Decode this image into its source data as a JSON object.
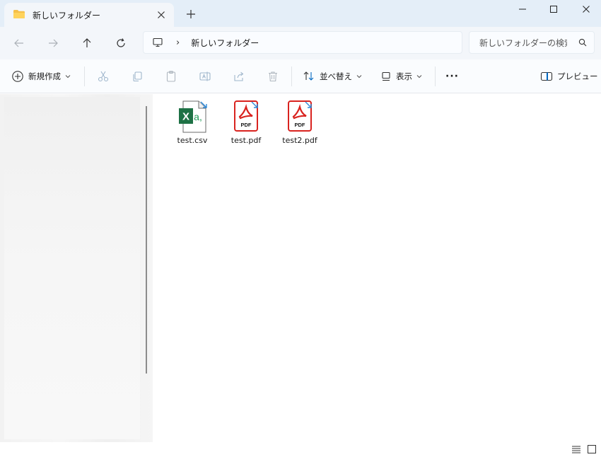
{
  "window": {
    "tab_title": "新しいフォルダー",
    "new_tab": "+",
    "minimize": "minimize",
    "maximize": "maximize",
    "close": "close"
  },
  "nav": {
    "path_separator": "›",
    "address_path": "新しいフォルダー",
    "search_placeholder": "新しいフォルダーの検索"
  },
  "toolbar": {
    "new_label": "新規作成",
    "sort_label": "並べ替え",
    "view_label": "表示",
    "more_label": "···",
    "preview_label": "プレビュー"
  },
  "files": [
    {
      "name": "test.csv",
      "type": "csv"
    },
    {
      "name": "test.pdf",
      "type": "pdf"
    },
    {
      "name": "test2.pdf",
      "type": "pdf"
    }
  ],
  "icons": {
    "pdf_badge": "PDF",
    "excel_letter": "X",
    "excel_sub": "a,"
  },
  "colors": {
    "accent": "#0067c0",
    "pdf_red": "#d9231f",
    "excel_green": "#1e7145"
  }
}
